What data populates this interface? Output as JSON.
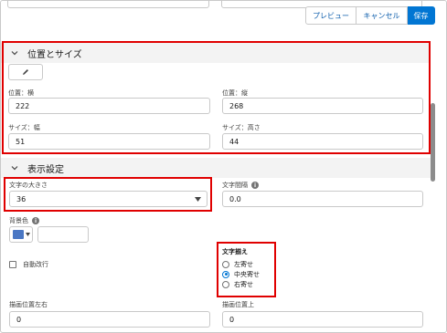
{
  "toolbar": {
    "preview_label": "プレビュー",
    "cancel_label": "キャンセル",
    "save_label": "保存"
  },
  "sections": {
    "position_size": {
      "title": "位置とサイズ",
      "pos_x_label": "位置：横",
      "pos_x_value": "222",
      "pos_y_label": "位置：縦",
      "pos_y_value": "268",
      "width_label": "サイズ：幅",
      "width_value": "51",
      "height_label": "サイズ：高さ",
      "height_value": "44"
    },
    "display": {
      "title": "表示設定",
      "font_size_label": "文字の大きさ",
      "font_size_value": "36",
      "letter_spacing_label": "文字間隔",
      "letter_spacing_value": "0.0",
      "bg_color_label": "背景色",
      "bg_color": "#4a77c4",
      "auto_wrap_label": "自動改行",
      "align_label": "文字揃え",
      "align_options": [
        "左寄せ",
        "中央寄せ",
        "右寄せ"
      ],
      "align_selected": "中央寄せ",
      "offset_x_label": "描画位置左右",
      "offset_x_value": "0",
      "offset_y_label": "描画位置上",
      "offset_y_value": "0"
    }
  },
  "colors": {
    "brand": "#0176d3",
    "highlight": "#e00000"
  }
}
